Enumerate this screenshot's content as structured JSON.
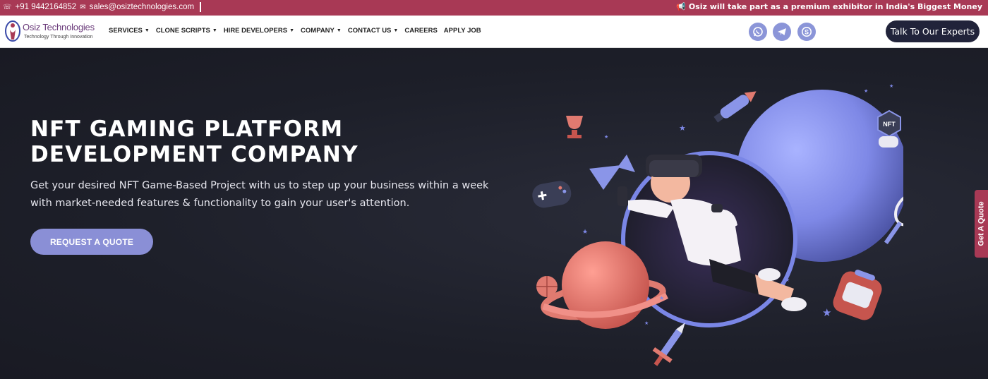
{
  "topbar": {
    "phone": "+91 9442164852",
    "email": "sales@osiztechnologies.com",
    "announcement": "Osiz will take part as a premium exhibitor in India's Biggest Money"
  },
  "brand": {
    "name": "Osiz Technologies",
    "tagline": "Technology Through Innovation"
  },
  "nav": {
    "items": [
      {
        "label": "SERVICES",
        "dropdown": true
      },
      {
        "label": "CLONE SCRIPTS",
        "dropdown": true
      },
      {
        "label": "HIRE DEVELOPERS",
        "dropdown": true
      },
      {
        "label": "COMPANY",
        "dropdown": true
      },
      {
        "label": "CONTACT US",
        "dropdown": true
      },
      {
        "label": "CAREERS",
        "dropdown": false
      },
      {
        "label": "APPLY JOB",
        "dropdown": false
      }
    ],
    "social_icons": [
      "whatsapp-icon",
      "telegram-icon",
      "skype-icon"
    ],
    "cta_label": "Talk To Our Experts"
  },
  "hero": {
    "title_line1": "NFT GAMING PLATFORM",
    "title_line2": "DEVELOPMENT COMPANY",
    "description": "Get your desired NFT Game-Based Project with us to step up your business within a week with market-needed features & functionality to gain your user's attention.",
    "button_label": "REQUEST A QUOTE",
    "nft_badge": "NFT"
  },
  "side_tab": {
    "label": "Get A Quote"
  },
  "colors": {
    "accent": "#a83955",
    "navy": "#21233a",
    "button": "#8a8fd6",
    "hero_bg": "#1d1f29"
  }
}
